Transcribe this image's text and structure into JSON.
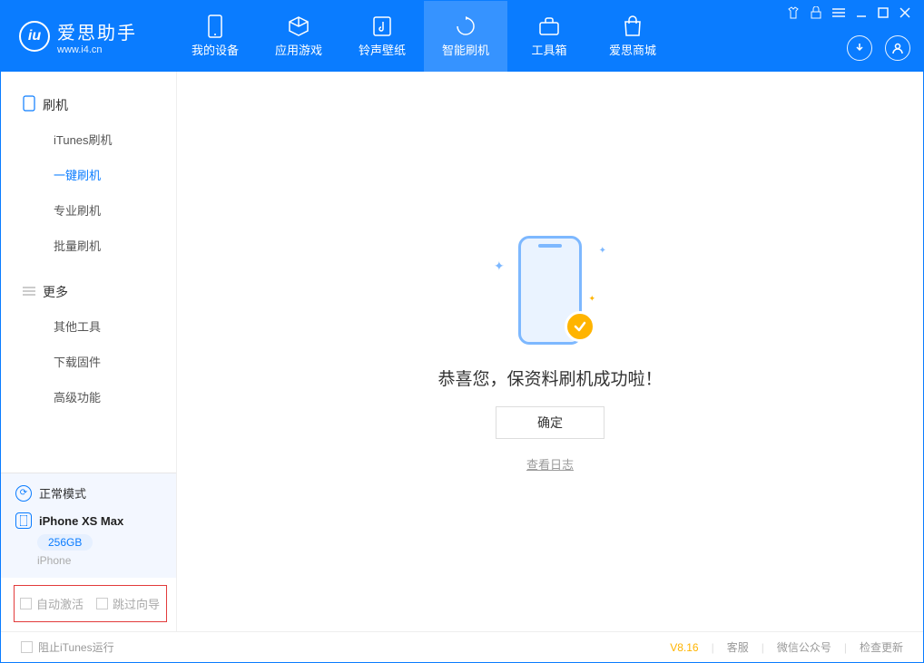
{
  "app": {
    "title": "爱思助手",
    "subtitle": "www.i4.cn"
  },
  "tabs": [
    {
      "label": "我的设备"
    },
    {
      "label": "应用游戏"
    },
    {
      "label": "铃声壁纸"
    },
    {
      "label": "智能刷机"
    },
    {
      "label": "工具箱"
    },
    {
      "label": "爱思商城"
    }
  ],
  "sidebar": {
    "section1_title": "刷机",
    "items1": [
      {
        "label": "iTunes刷机"
      },
      {
        "label": "一键刷机"
      },
      {
        "label": "专业刷机"
      },
      {
        "label": "批量刷机"
      }
    ],
    "section2_title": "更多",
    "items2": [
      {
        "label": "其他工具"
      },
      {
        "label": "下载固件"
      },
      {
        "label": "高级功能"
      }
    ]
  },
  "device": {
    "mode": "正常模式",
    "name": "iPhone XS Max",
    "storage": "256GB",
    "type": "iPhone"
  },
  "options": {
    "auto_activate": "自动激活",
    "skip_wizard": "跳过向导"
  },
  "main": {
    "message": "恭喜您，保资料刷机成功啦！",
    "confirm": "确定",
    "view_log": "查看日志"
  },
  "status": {
    "block_itunes": "阻止iTunes运行",
    "version": "V8.16",
    "support": "客服",
    "wechat": "微信公众号",
    "check_update": "检查更新"
  }
}
